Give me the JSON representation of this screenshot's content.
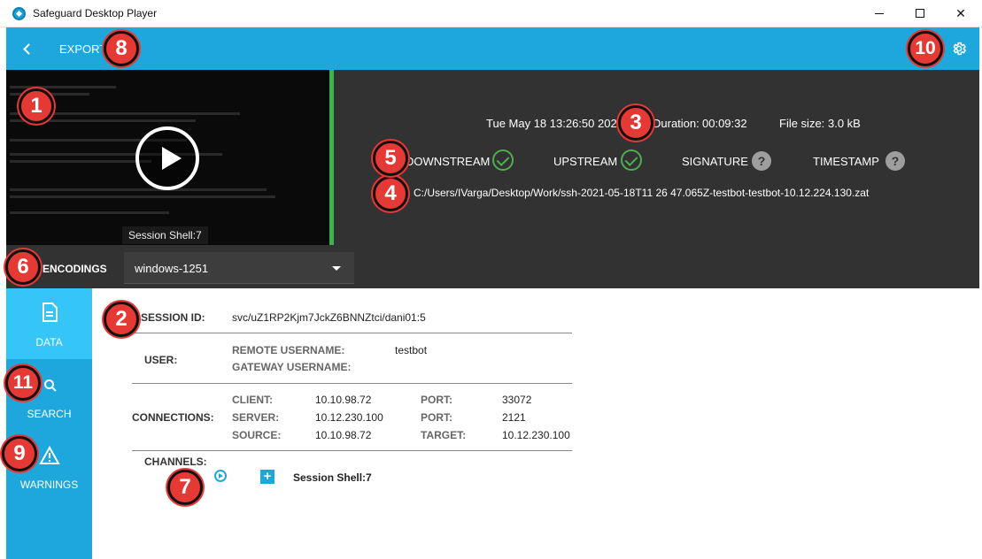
{
  "window": {
    "title": "Safeguard Desktop Player",
    "minimize_glyph": "",
    "close_glyph": "✕"
  },
  "appbar": {
    "back_icon": "chevron-left-icon",
    "title": "EXPORT",
    "settings_icon": "gear-icon"
  },
  "preview": {
    "caption": "Session Shell:7",
    "play_icon": "play-icon"
  },
  "meta": {
    "date": "Tue May 18 13:26:50 2021",
    "duration_label": "Duration:",
    "duration_value": "00:09:32",
    "filesize_label": "File size:",
    "filesize_value": "3.0 kB"
  },
  "status": [
    {
      "label": "DOWNSTREAM",
      "state": "ok"
    },
    {
      "label": "UPSTREAM",
      "state": "ok"
    },
    {
      "label": "SIGNATURE",
      "state": "unknown"
    },
    {
      "label": "TIMESTAMP",
      "state": "unknown"
    }
  ],
  "file_path": "C:/Users/IVarga/Desktop/Work/ssh-2021-05-18T11 26 47.065Z-testbot-testbot-10.12.224.130.zat",
  "encodings": {
    "label": "ENCODINGS",
    "selected": "windows-1251"
  },
  "sidebar": {
    "items": [
      {
        "label": "DATA",
        "icon": "document-icon",
        "active": true
      },
      {
        "label": "SEARCH",
        "icon": "search-icon",
        "active": false
      },
      {
        "label": "WARNINGS",
        "icon": "warning-icon",
        "active": false
      }
    ]
  },
  "details": {
    "session_id_label": "SESSION ID:",
    "session_id_value": "svc/uZ1RP2Kjm7JckZ6BNNZtci/dani01:5",
    "user_label": "USER:",
    "remote_username_label": "REMOTE USERNAME:",
    "remote_username_value": "testbot",
    "gateway_username_label": "GATEWAY USERNAME:",
    "gateway_username_value": "",
    "connections_label": "CONNECTIONS:",
    "client_label": "CLIENT:",
    "client_value": "10.10.98.72",
    "server_label": "SERVER:",
    "server_value": "10.12.230.100",
    "source_label": "SOURCE:",
    "source_value": "10.10.98.72",
    "port1_label": "PORT:",
    "port1_value": "33072",
    "port2_label": "PORT:",
    "port2_value": "2121",
    "target_label": "TARGET:",
    "target_value": "10.12.230.100",
    "channels_label": "CHANNELS:",
    "channel_name": "Session Shell:7"
  },
  "callouts": [
    "1",
    "2",
    "3",
    "4",
    "5",
    "6",
    "7",
    "8",
    "9",
    "10",
    "11"
  ],
  "colors": {
    "accent": "#1ea7dd",
    "dark": "#323232",
    "ok": "#4caf50",
    "callout": "#e53935"
  }
}
